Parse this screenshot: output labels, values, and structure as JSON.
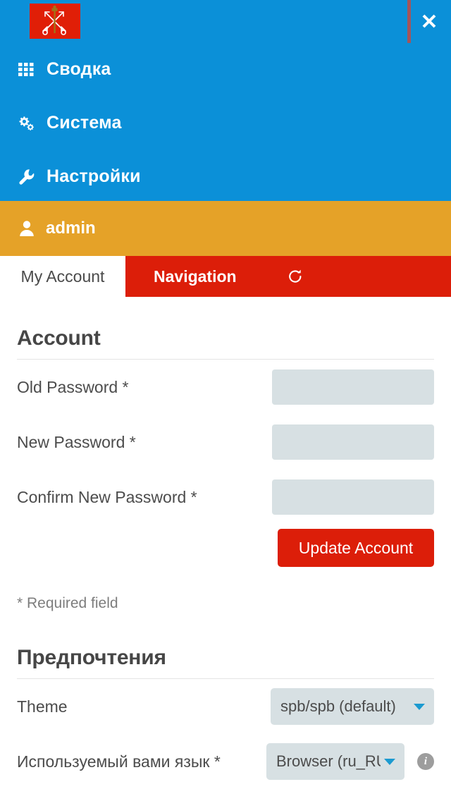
{
  "nav": {
    "logo_alt": "spb-coat-of-arms-logo",
    "close_label": "✕",
    "items": [
      {
        "icon": "grid-icon",
        "label": "Сводка"
      },
      {
        "icon": "cogs-icon",
        "label": "Система"
      },
      {
        "icon": "wrench-icon",
        "label": "Настройки"
      }
    ]
  },
  "user_bar": {
    "icon": "user-icon",
    "username": "admin"
  },
  "tabs": [
    {
      "label": "My Account",
      "active": true
    },
    {
      "label": "Navigation",
      "active": false
    }
  ],
  "tab_actions": {
    "refresh_icon": "refresh-icon"
  },
  "account": {
    "title": "Account",
    "fields": [
      {
        "label": "Old Password *",
        "value": "",
        "placeholder": ""
      },
      {
        "label": "New Password *",
        "value": "",
        "placeholder": ""
      },
      {
        "label": "Confirm New Password *",
        "value": "",
        "placeholder": ""
      }
    ],
    "submit_label": "Update Account",
    "required_note": "* Required field"
  },
  "preferences": {
    "title": "Предпочтения",
    "theme": {
      "label": "Theme",
      "value": "spb/spb (default)"
    },
    "language": {
      "label": "Используемый вами язык *",
      "value": "Browser (ru_RU)",
      "info_icon": "info-icon",
      "info_glyph": "i"
    }
  },
  "colors": {
    "sidebar_blue": "#0b90d8",
    "user_bar_orange": "#e5a228",
    "accent_red": "#dc1e09",
    "field_bg": "#d7e0e3",
    "text_dark": "#4c4c4c"
  }
}
